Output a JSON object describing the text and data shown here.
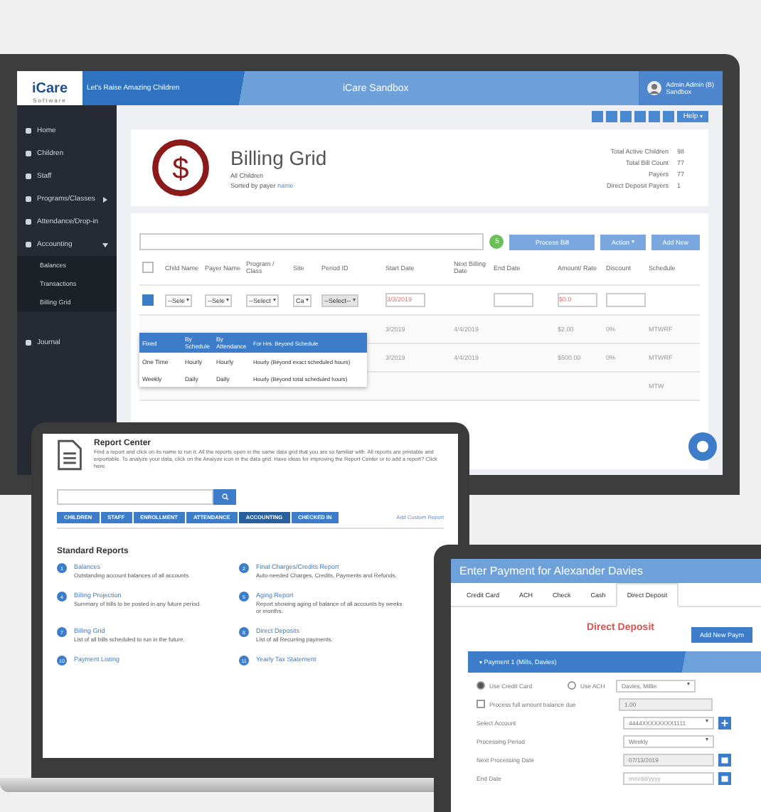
{
  "monitor": {
    "header": {
      "logo": "iCare",
      "logo_sub": "Software",
      "tagline": "Let's Raise Amazing Children",
      "title": "iCare Sandbox",
      "user": "Admin Admin (B)",
      "user_sub": "Sandbox"
    },
    "sidebar": {
      "items": [
        {
          "label": "Home"
        },
        {
          "label": "Children"
        },
        {
          "label": "Staff"
        },
        {
          "label": "Programs/Classes",
          "expanded": false
        },
        {
          "label": "Attendance/Drop-in"
        },
        {
          "label": "Accounting",
          "expanded": true,
          "children": [
            {
              "label": "Balances"
            },
            {
              "label": "Transactions"
            },
            {
              "label": "Billing Grid"
            }
          ]
        },
        {
          "label": "Journal"
        }
      ]
    },
    "toolbar": {
      "help": "Help"
    },
    "page": {
      "icon_glyph": "$",
      "title": "Billing Grid",
      "subtitle": "All Children",
      "sorted_by": "Sorted by payer",
      "sorted_link": "name",
      "stats": [
        {
          "label": "Total Active Children",
          "value": "98"
        },
        {
          "label": "Total Bill Count",
          "value": "77"
        },
        {
          "label": "Payers",
          "value": "77"
        },
        {
          "label": "Direct Deposit Payers",
          "value": "1"
        }
      ]
    },
    "grid": {
      "count": "5",
      "buttons": [
        {
          "label": "Process Bill",
          "kind": "plain"
        },
        {
          "label": "Action",
          "kind": "menu"
        },
        {
          "label": "Add New",
          "kind": "plain"
        }
      ],
      "columns": [
        "Child Name",
        "Payer Name",
        "Program / Class",
        "Site",
        "Period ID",
        "Start Date",
        "Next Billing Date",
        "End Date",
        "Amount/ Rate",
        "Discount",
        "Schedule"
      ],
      "header_checked": false,
      "filter": {
        "checked": true,
        "selects": [
          "--Sele",
          "--Sele",
          "--Select",
          "Ca",
          "--Select--"
        ],
        "start_date": "3/3/2019",
        "amount": "$0.0"
      },
      "dropdown": {
        "header": [
          "Fixed",
          "By Schedule",
          "By Attendance",
          "For Hrs. Beyond Schedule"
        ],
        "rows": [
          [
            "One Time",
            "Hourly",
            "Hourly",
            "Hourly (Beyond exact scheduled hours)"
          ],
          [
            "Weekly",
            "Daily",
            "Daily",
            "Hourly (Beyond total scheduled hours)"
          ]
        ]
      },
      "rows": [
        {
          "start_date": "3/2019",
          "next_billing": "4/4/2019",
          "amount": "$2.00",
          "discount": "0%",
          "schedule": "MTWRF"
        },
        {
          "start_date": "3/2019",
          "next_billing": "4/4/2019",
          "amount": "$500.00",
          "discount": "0%",
          "schedule": "MTWRF"
        },
        {
          "start_date": "",
          "next_billing": "",
          "amount": "",
          "discount": "",
          "schedule": "MTW"
        }
      ]
    }
  },
  "laptop": {
    "title": "Report Center",
    "intro": "Find a report and click on its name to run it. All the reports open in the same data grid that you are so familiar with. All reports are printable and exportable. To analyze your data, click on the Analyze icon in the data grid. Have ideas for improving the Report Center or to add a report? Click here.",
    "tabs": [
      {
        "label": "CHILDREN",
        "selected": false
      },
      {
        "label": "STAFF",
        "selected": false
      },
      {
        "label": "ENROLLMENT",
        "selected": false
      },
      {
        "label": "ATTENDANCE",
        "selected": false
      },
      {
        "label": "ACCOUNTING",
        "selected": true
      },
      {
        "label": "CHECKED IN",
        "selected": false
      }
    ],
    "custom_link": "Add Custom Report",
    "section": "Standard Reports",
    "reports": [
      {
        "num": "1",
        "title": "Balances",
        "desc": "Outstanding account balances of all accounts."
      },
      {
        "num": "2",
        "title": "Final Charges/Credits Report",
        "desc": "Auto-needed Charges, Credits, Payments and Refunds."
      },
      {
        "num": "4",
        "title": "Billing Projection",
        "desc": "Summary of bills to be posted in any future period."
      },
      {
        "num": "5",
        "title": "Aging Report",
        "desc": "Report showing aging of balance of all accounts by weeks or months."
      },
      {
        "num": "7",
        "title": "Billing Grid",
        "desc": "List of all bills scheduled to run in the future."
      },
      {
        "num": "8",
        "title": "Direct Deposits",
        "desc": "List of all Recurring payments."
      },
      {
        "num": "10",
        "title": "Payment Listing"
      },
      {
        "num": "11",
        "title": "Yearly Tax Statement"
      }
    ]
  },
  "tablet": {
    "title": "Enter Payment for Alexander Davies",
    "tabs": [
      {
        "label": "Credit Card",
        "selected": false
      },
      {
        "label": "ACH",
        "selected": false
      },
      {
        "label": "Check",
        "selected": false
      },
      {
        "label": "Cash",
        "selected": false
      },
      {
        "label": "Direct Deposit",
        "selected": true
      }
    ],
    "heading": "Direct Deposit",
    "add_button": "Add New Paym",
    "panel": "Payment 1 (Mills, Davies)",
    "use_card": {
      "label": "Use Credit Card",
      "selected": true
    },
    "use_ach": {
      "label": "Use ACH",
      "selected": false
    },
    "payer": "Davies, Millie",
    "full_amount": {
      "label": "Process full amount balance due",
      "checked": false
    },
    "amount": "1.00",
    "fields": [
      {
        "label": "Select Account",
        "value": "4444XXXXXXXX1111",
        "kind": "select-add"
      },
      {
        "label": "Processing Period",
        "value": "Weekly",
        "kind": "select"
      },
      {
        "label": "Next Processing Date",
        "value": "07/13/2019",
        "kind": "date"
      },
      {
        "label": "End Date",
        "placeholder": "mm/dd/yyyy",
        "kind": "date"
      }
    ]
  }
}
